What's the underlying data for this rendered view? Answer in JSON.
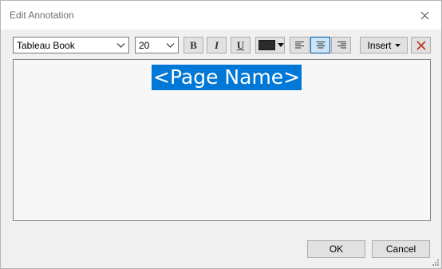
{
  "dialog": {
    "title": "Edit Annotation"
  },
  "toolbar": {
    "font_family": "Tableau Book",
    "font_size": "20",
    "bold_label": "B",
    "italic_label": "I",
    "underline_label": "U",
    "font_color": "#2b2b2b",
    "align_active": "center",
    "insert_label": "Insert"
  },
  "editor": {
    "selected_text": "<Page Name>",
    "selection_color": "#0078d7"
  },
  "footer": {
    "ok_label": "OK",
    "cancel_label": "Cancel"
  },
  "colors": {
    "accent": "#0078d7",
    "clear_icon": "#c0392b"
  }
}
